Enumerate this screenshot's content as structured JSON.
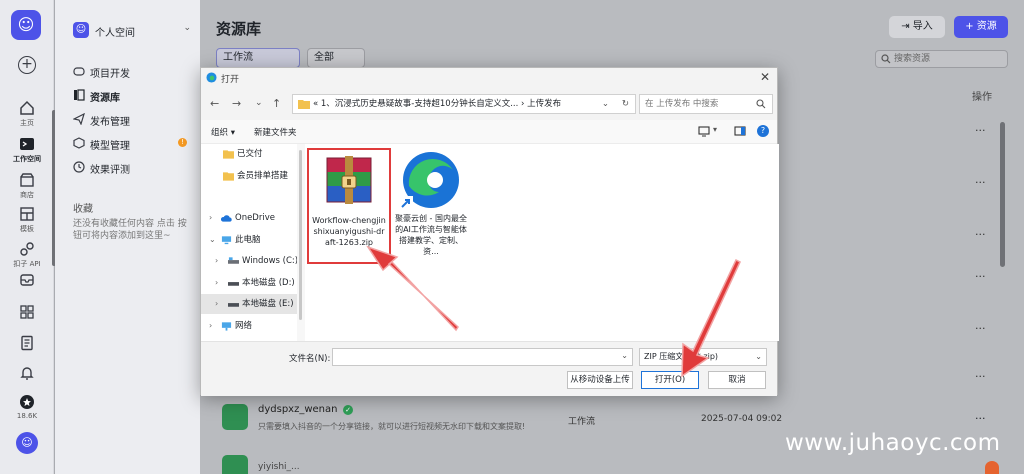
{
  "colors": {
    "brand": "#4d53e8",
    "annotation_red": "#e03b3b",
    "success": "#2f9e57"
  },
  "rail": {
    "items": [
      {
        "label": "主页",
        "icon": "home-icon"
      },
      {
        "label": "工作空间",
        "icon": "terminal-icon"
      },
      {
        "label": "商店",
        "icon": "store-icon"
      },
      {
        "label": "模板",
        "icon": "template-icon"
      },
      {
        "label": "扣子 API",
        "icon": "api-icon"
      }
    ],
    "badge_count": "18.6K"
  },
  "nav": {
    "space": "个人空间",
    "items": [
      {
        "label": "项目开发",
        "icon": "gamepad-icon"
      },
      {
        "label": "资源库",
        "icon": "library-icon"
      },
      {
        "label": "发布管理",
        "icon": "send-icon"
      },
      {
        "label": "模型管理",
        "icon": "cube-icon",
        "badge": "!"
      },
      {
        "label": "效果评测",
        "icon": "evaluate-icon"
      }
    ],
    "favorites_title": "收藏",
    "favorites_empty": "还没有收藏任何内容 点击 按钮可将内容添加到这里~"
  },
  "main": {
    "title": "资源库",
    "import_label": "导入",
    "add_resource_label": "+ 资源",
    "filter_type": "工作流",
    "filter_scope": "全部",
    "search_placeholder": "搜索资源",
    "col_ops": "操作",
    "row": {
      "name": "dydspxz_wenan",
      "desc": "只需要填入抖音的一个分享链接，就可以进行短视频无水印下载和文案提取!",
      "type": "工作流",
      "date": "2025-07-04 09:02",
      "more": "···"
    },
    "row_next_peek": "yiyishi_..."
  },
  "dialog": {
    "title": "打开",
    "path": "«  1、沉浸式历史悬疑故事-支持超10分钟长自定义文...  ›  上传发布",
    "search_placeholder": "在 上传发布 中搜索",
    "organize": "组织 ▾",
    "new_folder": "新建文件夹",
    "tree": [
      {
        "label": "已交付",
        "icon": "folder-icon"
      },
      {
        "label": "会员排单搭建",
        "icon": "folder-icon"
      },
      {
        "label": "OneDrive",
        "icon": "cloud-icon"
      },
      {
        "label": "此电脑",
        "icon": "pc-icon"
      },
      {
        "label": "Windows (C:)",
        "icon": "drive-icon"
      },
      {
        "label": "本地磁盘 (D:)",
        "icon": "drive-icon"
      },
      {
        "label": "本地磁盘 (E:)",
        "icon": "drive-icon"
      },
      {
        "label": "网络",
        "icon": "network-icon"
      }
    ],
    "files": [
      {
        "name": "Workflow-chengjinshixuanyigushi-draft-1263.zip",
        "icon": "winrar-zip-icon"
      },
      {
        "name": "聚豪云创 - 国内最全的AI工作流与智能体搭建教学、定制、资...",
        "icon": "edge-shortcut-icon"
      }
    ],
    "filename_label": "文件名(N):",
    "filename_value": "",
    "filetype": "ZIP 压缩文件 (*.zip)",
    "from_mobile": "从移动设备上传",
    "open": "打开(O)",
    "cancel": "取消"
  },
  "watermark": "www.juhaoyc.com"
}
